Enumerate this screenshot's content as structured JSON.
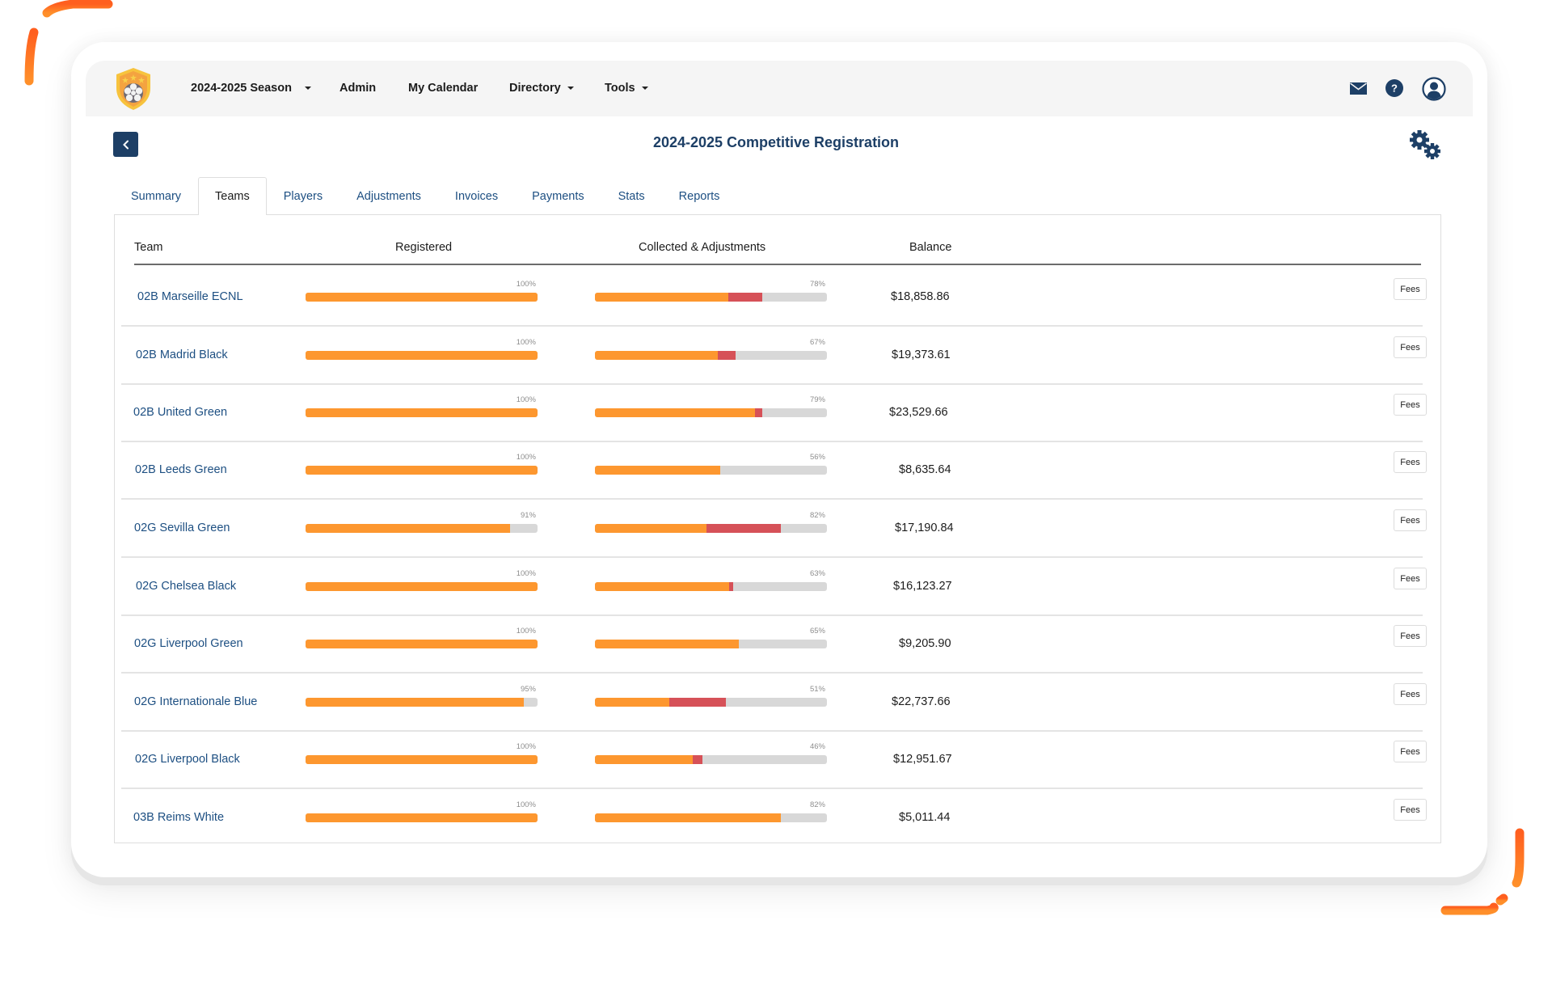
{
  "nav": {
    "season": "2024-2025 Season",
    "admin": "Admin",
    "calendar": "My Calendar",
    "directory": "Directory",
    "tools": "Tools"
  },
  "header_icons": [
    "mail-icon",
    "help-icon",
    "user-account-icon"
  ],
  "page": {
    "title": "2024-2025 Competitive Registration"
  },
  "tabs": [
    {
      "label": "Summary",
      "active": false
    },
    {
      "label": "Teams",
      "active": true
    },
    {
      "label": "Players",
      "active": false
    },
    {
      "label": "Adjustments",
      "active": false
    },
    {
      "label": "Invoices",
      "active": false
    },
    {
      "label": "Payments",
      "active": false
    },
    {
      "label": "Stats",
      "active": false
    },
    {
      "label": "Reports",
      "active": false
    }
  ],
  "table": {
    "columns": [
      "Team",
      "Registered",
      "Collected & Adjustments",
      "Balance"
    ],
    "fees_label": "Fees",
    "rows": [
      {
        "team": "02B Marseille ECNL",
        "registered_pct": 100,
        "registered_label": "100%",
        "collected_pct": 57.5,
        "adjustment_pct": 14.5,
        "collected_label": "78%",
        "balance": "$18,858.86"
      },
      {
        "team": "02B Madrid Black",
        "registered_pct": 100,
        "registered_label": "100%",
        "collected_pct": 53,
        "adjustment_pct": 7.5,
        "collected_label": "67%",
        "balance": "$19,373.61"
      },
      {
        "team": "02B United Green",
        "registered_pct": 100,
        "registered_label": "100%",
        "collected_pct": 69,
        "adjustment_pct": 3,
        "collected_label": "79%",
        "balance": "$23,529.66"
      },
      {
        "team": "02B Leeds Green",
        "registered_pct": 100,
        "registered_label": "100%",
        "collected_pct": 54,
        "adjustment_pct": 0,
        "collected_label": "56%",
        "balance": "$8,635.64"
      },
      {
        "team": "02G Sevilla Green",
        "registered_pct": 88,
        "registered_label": "91%",
        "collected_pct": 48,
        "adjustment_pct": 32,
        "collected_label": "82%",
        "balance": "$17,190.84"
      },
      {
        "team": "02G Chelsea Black",
        "registered_pct": 100,
        "registered_label": "100%",
        "collected_pct": 58,
        "adjustment_pct": 1.5,
        "collected_label": "63%",
        "balance": "$16,123.27"
      },
      {
        "team": "02G Liverpool Green",
        "registered_pct": 100,
        "registered_label": "100%",
        "collected_pct": 62,
        "adjustment_pct": 0,
        "collected_label": "65%",
        "balance": "$9,205.90"
      },
      {
        "team": "02G Internationale Blue",
        "registered_pct": 94,
        "registered_label": "95%",
        "collected_pct": 32,
        "adjustment_pct": 24.5,
        "collected_label": "51%",
        "balance": "$22,737.66"
      },
      {
        "team": "02G Liverpool Black",
        "registered_pct": 100,
        "registered_label": "100%",
        "collected_pct": 42,
        "adjustment_pct": 4.5,
        "collected_label": "46%",
        "balance": "$12,951.67"
      },
      {
        "team": "03B Reims White",
        "registered_pct": 100,
        "registered_label": "100%",
        "collected_pct": 80,
        "adjustment_pct": 0,
        "collected_label": "82%",
        "balance": "$5,011.44"
      }
    ]
  },
  "colors": {
    "brand_navy": "#1d3f66",
    "link_blue": "#1d4f82",
    "progress_orange": "#fd972f",
    "adjustment_red": "#d65158",
    "progress_track": "#d8d8d8",
    "decor_orange": "#ff5f1f"
  }
}
